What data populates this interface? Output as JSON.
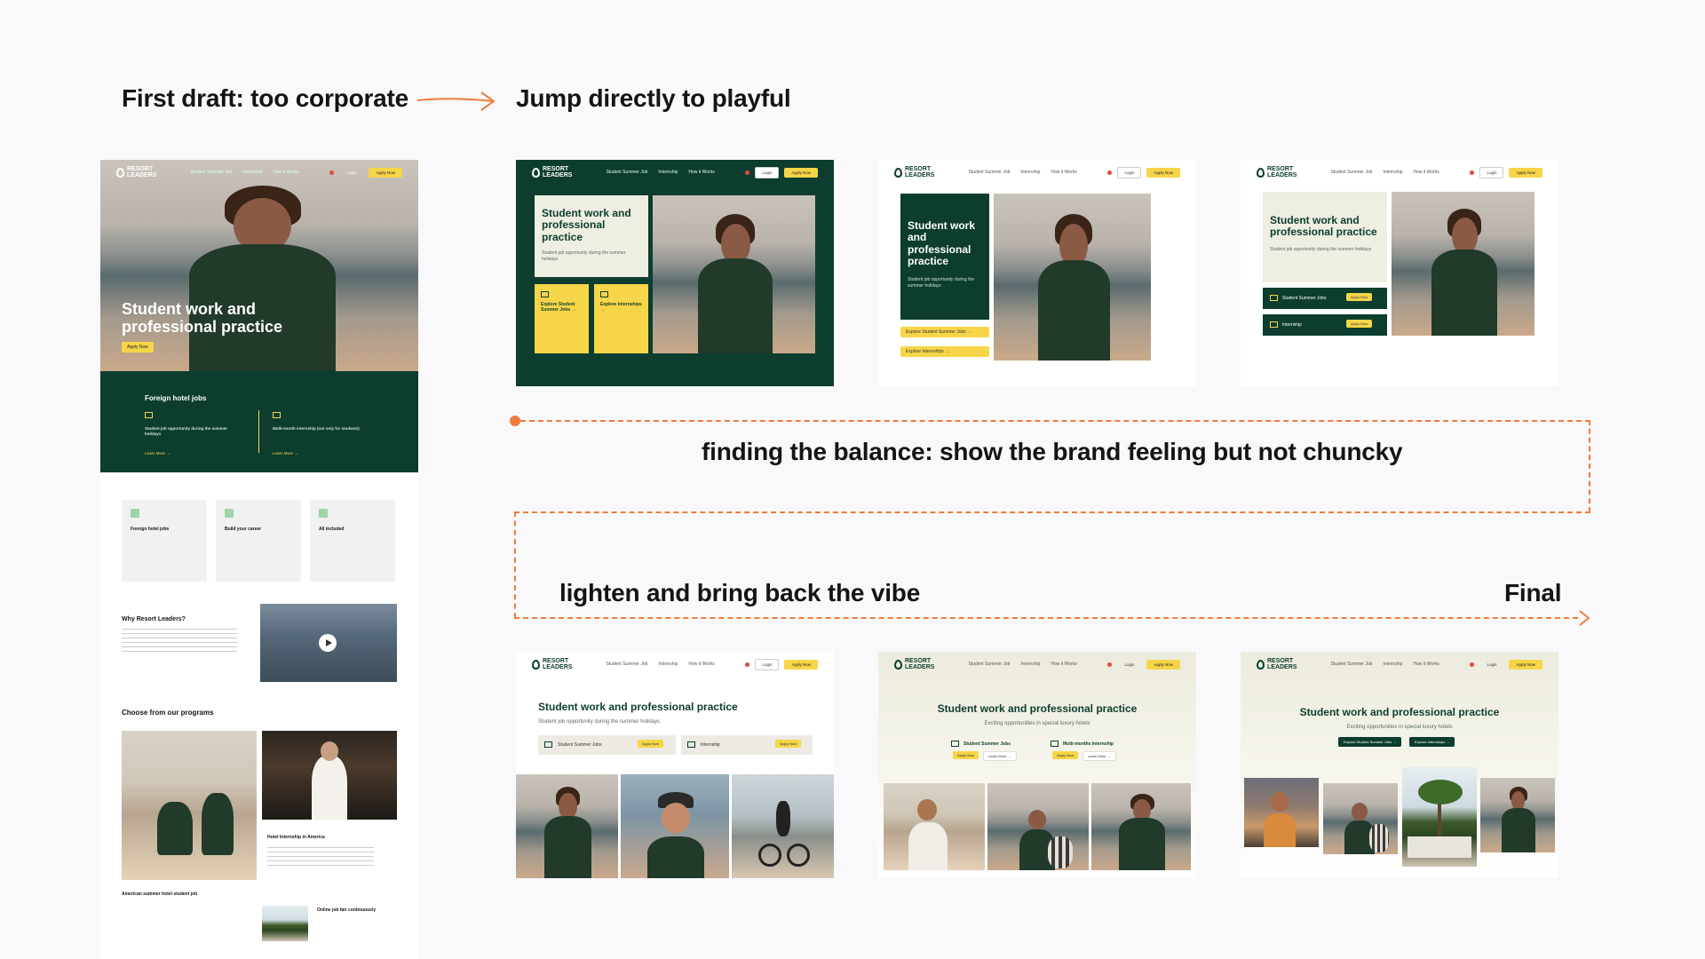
{
  "headings": {
    "first_draft": "First draft: too corporate",
    "playful": "Jump directly to playful",
    "balance": "finding the balance: show the brand feeling but not chuncky",
    "lighten": "lighten and bring back the vibe",
    "final": "Final"
  },
  "colors": {
    "brand_green": "#0c3d2e",
    "brand_yellow": "#f7d548",
    "connector_orange": "#ef7b3a",
    "canvas": "#f9f9fb"
  },
  "mock": {
    "brand": [
      "RESORT",
      "LEADERS"
    ],
    "nav": [
      "Student Summer Job",
      "Internship",
      "How it Works"
    ],
    "login": "Login",
    "apply": "Apply Now",
    "hero_title": "Student work and professional practice",
    "hero_sub": "Student job opportunity during the summer holidays",
    "hero_sub_final": "Exciting opportunities in special luxury hotels",
    "explore_jobs": "Explore Student Summer Jobs →",
    "explore_intern": "Explore Internships →",
    "summer_jobs": "Student Summer Jobs",
    "internship": "Internship",
    "multi_internship": "Multi-months Internship",
    "learn_more": "Learn More →",
    "foreign_hotel_jobs": "Foreign hotel jobs",
    "build_career": "Build your career",
    "all_included": "All included",
    "why": "Why Resort Leaders?",
    "programs": "Choose from our programs",
    "summer_program": "American summer hotel student job",
    "hotel_internship": "Hotel Internship in America",
    "online_job": "Online job fair continuously",
    "opp_summer": "Student job opportunity during the summer holidays",
    "opp_intern": "Multi-month internship (not only for students)"
  }
}
